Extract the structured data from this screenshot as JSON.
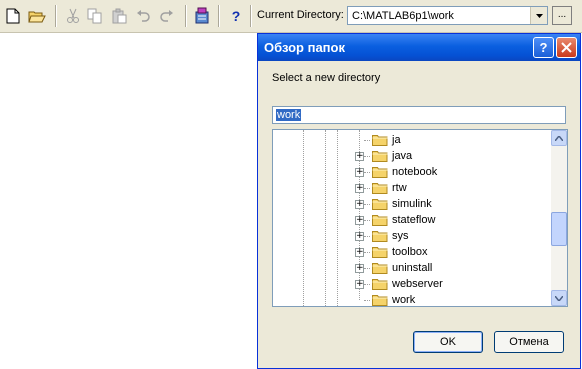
{
  "toolbar": {
    "icons": [
      "new-file-icon",
      "open-folder-icon",
      "cut-icon",
      "copy-icon",
      "paste-icon",
      "undo-icon",
      "redo-icon",
      "simulink-icon",
      "help-icon"
    ],
    "current_directory_label": "Current Directory:",
    "current_directory_value": "C:\\MATLAB6p1\\work",
    "browse_label": "..."
  },
  "dialog": {
    "title": "Обзор папок",
    "help_label": "?",
    "prompt": "Select a new directory",
    "path_value": "work",
    "tree": [
      {
        "label": "ja",
        "expandable": false
      },
      {
        "label": "java",
        "expandable": true
      },
      {
        "label": "notebook",
        "expandable": true
      },
      {
        "label": "rtw",
        "expandable": true
      },
      {
        "label": "simulink",
        "expandable": true
      },
      {
        "label": "stateflow",
        "expandable": true
      },
      {
        "label": "sys",
        "expandable": true
      },
      {
        "label": "toolbox",
        "expandable": true
      },
      {
        "label": "uninstall",
        "expandable": true
      },
      {
        "label": "webserver",
        "expandable": true
      },
      {
        "label": "work",
        "expandable": false
      }
    ],
    "ok_label": "OK",
    "cancel_label": "Отмена"
  },
  "colors": {
    "titlebar": "#0a5fe0",
    "dialog_bg": "#ece9d8",
    "folder": "#f5d36a",
    "selection": "#316ac5"
  }
}
